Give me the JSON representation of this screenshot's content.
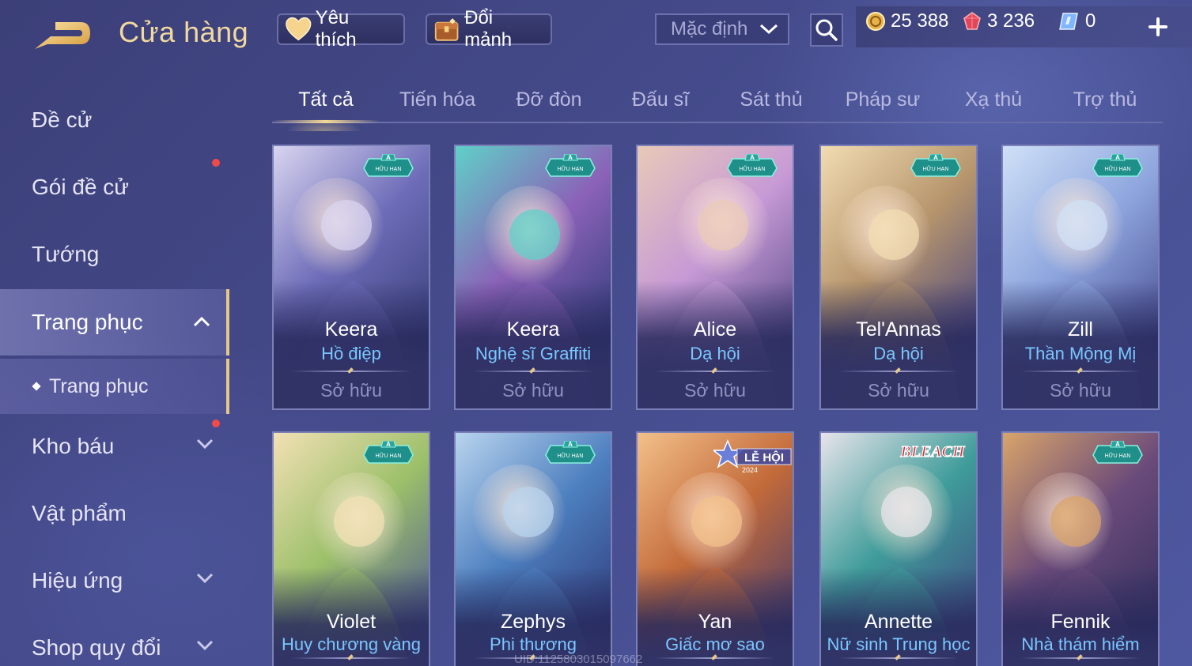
{
  "header": {
    "title": "Cửa hàng",
    "favorite_label": "Yêu thích",
    "exchange_label": "Đổi mảnh",
    "sort_value": "Mặc định"
  },
  "currencies": {
    "gold": "25 388",
    "ruby": "3 236",
    "voucher": "0"
  },
  "sidebar": {
    "items": [
      {
        "label": "Đề cử"
      },
      {
        "label": "Gói đề cử"
      },
      {
        "label": "Tướng"
      },
      {
        "label": "Trang phục"
      },
      {
        "label": "Trang phục"
      },
      {
        "label": "Kho báu"
      },
      {
        "label": "Vật phẩm"
      },
      {
        "label": "Hiệu ứng"
      },
      {
        "label": "Shop quy đổi"
      }
    ]
  },
  "tabs": [
    {
      "label": "Tất cả"
    },
    {
      "label": "Tiến hóa"
    },
    {
      "label": "Đỡ đòn"
    },
    {
      "label": "Đấu sĩ"
    },
    {
      "label": "Sát thủ"
    },
    {
      "label": "Pháp sư"
    },
    {
      "label": "Xạ thủ"
    },
    {
      "label": "Trợ thủ"
    }
  ],
  "cards": [
    {
      "hero": "Keera",
      "skin": "Hồ điệp",
      "status": "Sở hữu",
      "colors": [
        "#d8d4f0",
        "#6d6cb8",
        "#3a3f7a"
      ]
    },
    {
      "hero": "Keera",
      "skin": "Nghệ sĩ Graffiti",
      "status": "Sở hữu",
      "colors": [
        "#5fd0c8",
        "#8b62b8",
        "#2f3b7a"
      ]
    },
    {
      "hero": "Alice",
      "skin": "Dạ hội",
      "status": "Sở hữu",
      "colors": [
        "#e9c9b8",
        "#c79ad6",
        "#5a4d8a"
      ]
    },
    {
      "hero": "Tel'Annas",
      "skin": "Dạ hội",
      "status": "Sở hữu",
      "colors": [
        "#f2dcb2",
        "#b6956c",
        "#4a4682"
      ]
    },
    {
      "hero": "Zill",
      "skin": "Thần Mộng Mị",
      "status": "Sở hữu",
      "colors": [
        "#cfe0f7",
        "#8ea6de",
        "#4a4f95"
      ]
    },
    {
      "hero": "Violet",
      "skin": "Huy chương vàng",
      "status": "",
      "colors": [
        "#f2e0b4",
        "#9cc06a",
        "#4f5a92"
      ]
    },
    {
      "hero": "Zephys",
      "skin": "Phi thương",
      "status": "",
      "colors": [
        "#b8d4ee",
        "#4d7fbf",
        "#2f3b7a"
      ]
    },
    {
      "hero": "Yan",
      "skin": "Giấc mơ sao",
      "status": "",
      "colors": [
        "#f3c08a",
        "#c36a3a",
        "#4a3c6a"
      ]
    },
    {
      "hero": "Annette",
      "skin": "Nữ sinh Trung học",
      "status": "",
      "colors": [
        "#e7e4ea",
        "#3f9c9a",
        "#3f4b82"
      ]
    },
    {
      "hero": "Fennik",
      "skin": "Nhà thám hiểm",
      "status": "",
      "colors": [
        "#d9a46a",
        "#6a4a7a",
        "#33305e"
      ]
    }
  ],
  "badges": {
    "limited_top": "A",
    "limited_bottom": "HỮU HẠN",
    "festival": "LỄ HỘI",
    "festival_year": "2024",
    "bleach": "BLEACH"
  },
  "uid_text": "UID:1125803015097662"
}
